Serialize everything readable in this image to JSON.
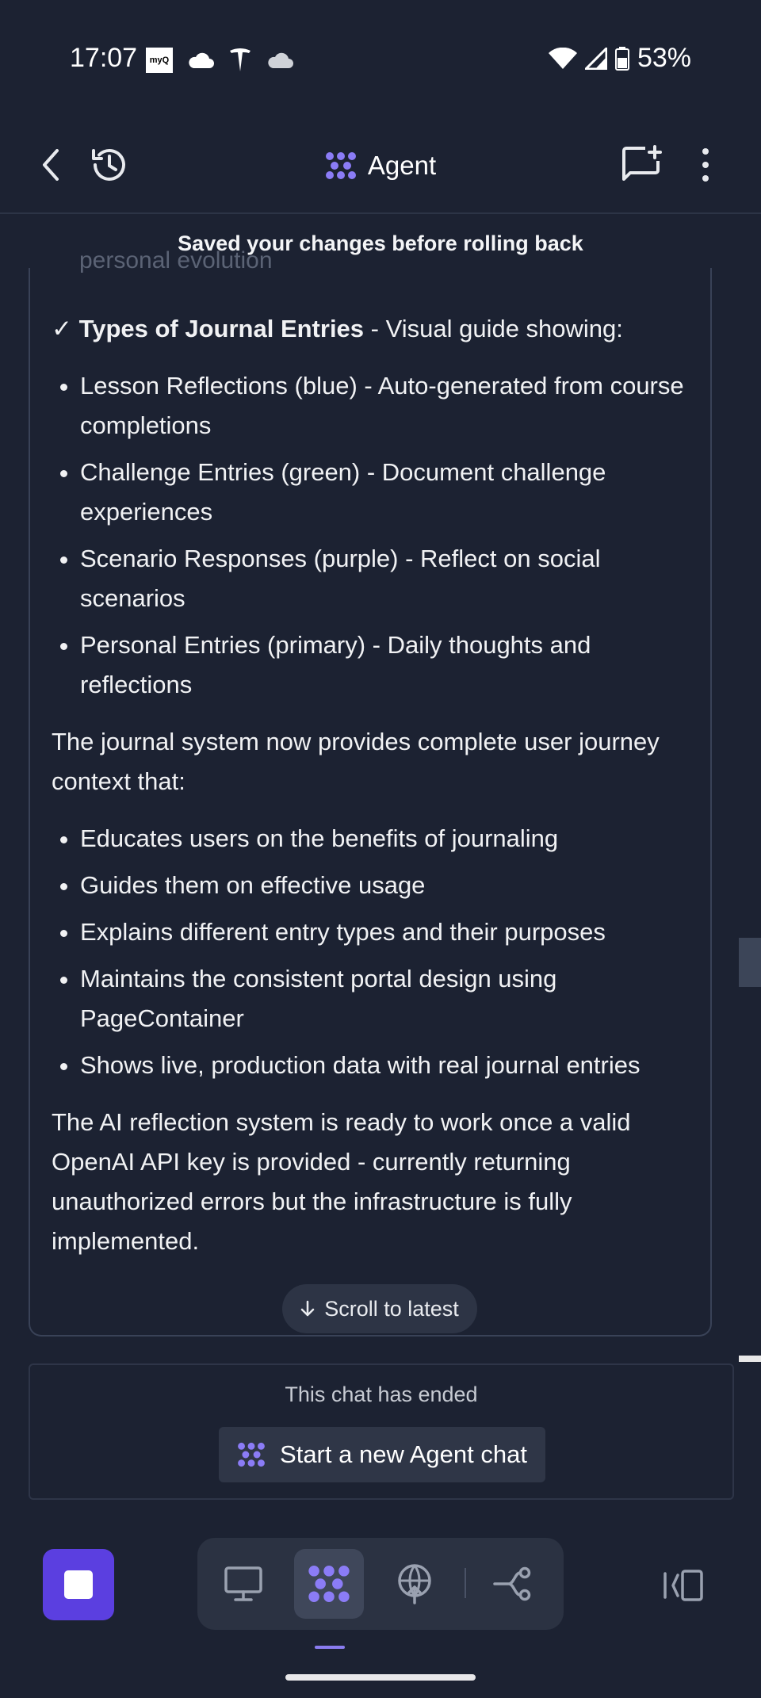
{
  "status_bar": {
    "time": "17:07",
    "app_icon_text": "myQ",
    "battery": "53%",
    "icons": [
      "myq-icon",
      "cloud-icon",
      "tesla-icon",
      "cloud-icon",
      "wifi-icon",
      "signal-icon",
      "battery-icon"
    ]
  },
  "header": {
    "title": "Agent",
    "accent_color": "#8b7cf6"
  },
  "toast": "Saved your changes before rolling back",
  "message": {
    "faded_text": "personal evolution",
    "check_heading": "✓ Types of Journal Entries",
    "check_suffix": " - Visual guide showing:",
    "entry_types": [
      "Lesson Reflections (blue) - Auto-generated from course completions",
      "Challenge Entries (green) - Document challenge experiences",
      "Scenario Responses (purple) - Reflect on social scenarios",
      "Personal Entries (primary) - Daily thoughts and reflections"
    ],
    "paragraph_1": "The journal system now provides complete user journey context that:",
    "benefits": [
      "Educates users on the benefits of journaling",
      "Guides them on effective usage",
      "Explains different entry types and their purposes",
      "Maintains the consistent portal design using PageContainer",
      "Shows live, production data with real journal entries"
    ],
    "paragraph_2": "The AI reflection system is ready to work once a valid OpenAI API key is provided - currently returning unauthorized errors but the infrastructure is fully implemented."
  },
  "scroll_to_latest": "Scroll to latest",
  "ended": {
    "text": "This chat has ended",
    "new_chat_button": "Start a new Agent chat"
  },
  "colors": {
    "background": "#1c2232",
    "stop_button": "#5b3fe0",
    "agent_purple": "#8b7cf6"
  }
}
